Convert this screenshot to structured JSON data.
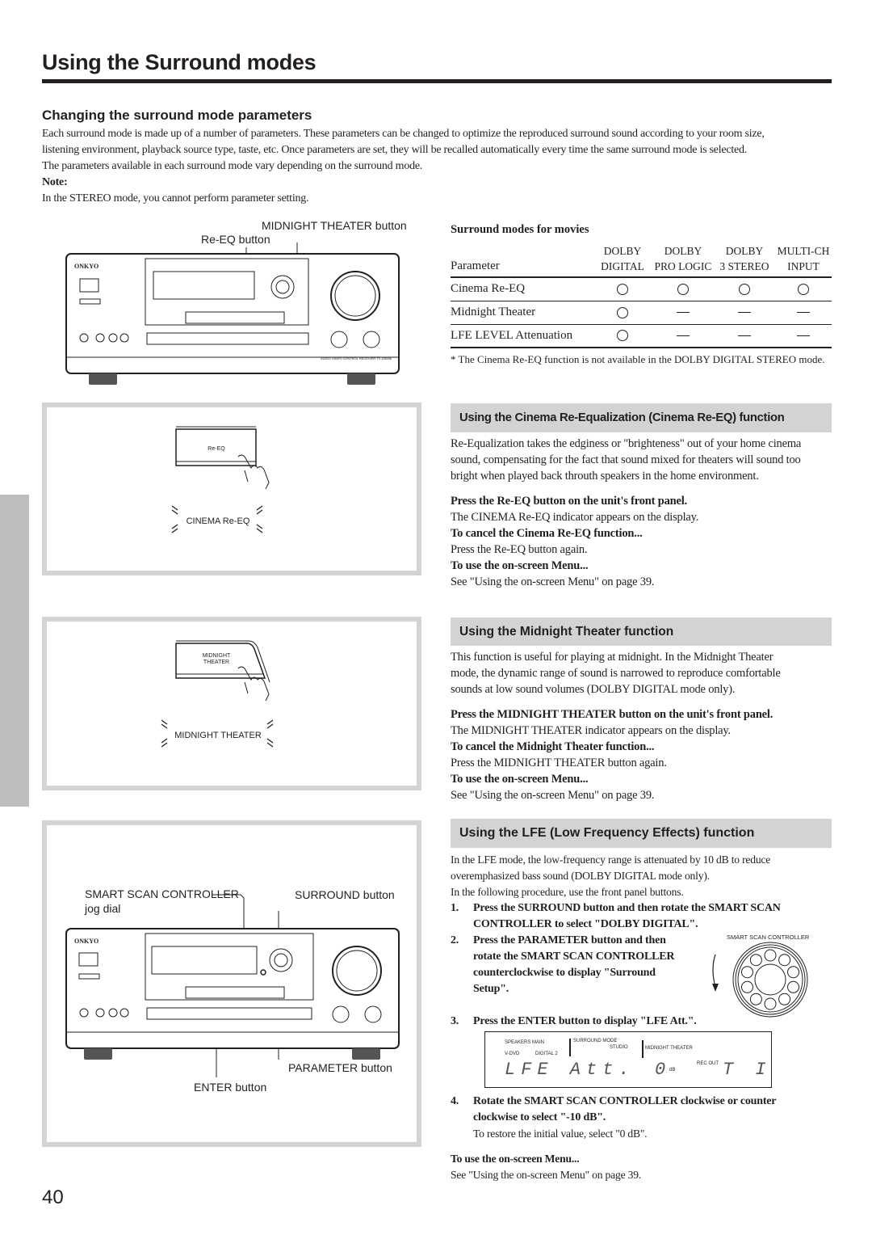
{
  "page": {
    "title": "Using the Surround modes",
    "number": "40"
  },
  "intro": {
    "heading": "Changing the surround mode parameters",
    "lines": [
      "Each surround mode is made up of a number of parameters. These parameters can be changed to optimize the reproduced surround sound according to your room size,",
      "listening environment, playback source type, taste, etc. Once parameters are set, they will be recalled automatically every time the same surround mode is selected.",
      "The parameters available in each surround mode vary depending on the surround mode."
    ],
    "note_label": "Note:",
    "note_text": "In the STEREO mode, you cannot perform parameter setting."
  },
  "figure_top": {
    "callout_midnight": "MIDNIGHT THEATER button",
    "callout_reeq": "Re-EQ button",
    "brand": "ONKYO",
    "model": "AUDIO VIDEO CONTROL RECEIVER  TX-DS656"
  },
  "movies_table": {
    "title": "Surround modes for movies",
    "param_header": "Parameter",
    "columns": [
      {
        "line1": "DOLBY",
        "line2": "DIGITAL"
      },
      {
        "line1": "DOLBY",
        "line2": "PRO LOGIC"
      },
      {
        "line1": "DOLBY",
        "line2": "3 STEREO"
      },
      {
        "line1": "MULTI-CH",
        "line2": "INPUT"
      }
    ],
    "rows": [
      {
        "label": "Cinema Re-EQ",
        "values": [
          "available",
          "available",
          "available",
          "available"
        ]
      },
      {
        "label": "Midnight Theater",
        "values": [
          "available",
          "not-available",
          "not-available",
          "not-available"
        ]
      },
      {
        "label": "LFE LEVEL Attenuation",
        "values": [
          "available",
          "not-available",
          "not-available",
          "not-available"
        ]
      }
    ],
    "footnote": "* The Cinema Re-EQ function is not available in the DOLBY DIGITAL STEREO mode."
  },
  "reeq": {
    "heading": "Using the Cinema Re-Equalization (Cinema Re-EQ) function",
    "body": [
      "Re-Equalization takes the edginess or \"brighteness\" out of your home cinema",
      "sound, compensating for the fact that sound mixed for theaters will sound too",
      "bright when played back throuth speakers in the home environment."
    ],
    "press": "Press the Re-EQ button on the unit's front panel.",
    "press_result": "The CINEMA Re-EQ indicator appears on the display.",
    "cancel_title": "To cancel the Cinema Re-EQ function...",
    "cancel_text": "Press the Re-EQ button again.",
    "menu_title": "To use the on-screen Menu...",
    "menu_text": "See \"Using the on-screen Menu\" on page 39.",
    "figure_button": "Re-EQ",
    "figure_indicator": "CINEMA  Re-EQ"
  },
  "midnight": {
    "heading": "Using the Midnight Theater function",
    "body": [
      "This function is useful for playing at midnight. In the Midnight Theater",
      "mode, the dynamic range of sound is narrowed to reproduce comfortable",
      "sounds at low sound volumes (DOLBY DIGITAL mode only)."
    ],
    "press": "Press the MIDNIGHT THEATER button on the unit's front panel.",
    "press_result": "The MIDNIGHT THEATER indicator appears on the display.",
    "cancel_title": "To cancel the Midnight Theater function...",
    "cancel_text": "Press the MIDNIGHT THEATER button again.",
    "menu_title": "To use the on-screen Menu...",
    "menu_text": "See \"Using the on-screen Menu\" on page 39.",
    "figure_button_1": "MIDNIGHT",
    "figure_button_2": "THEATER",
    "figure_indicator": "MIDNIGHT THEATER"
  },
  "lfe": {
    "heading": "Using the LFE (Low Frequency Effects) function",
    "body": [
      "In the LFE mode, the low-frequency range is attenuated by 10 dB to reduce",
      "overemphasized bass sound (DOLBY DIGITAL mode only).",
      "In the following procedure, use the front panel buttons."
    ],
    "steps": [
      {
        "num": "1.",
        "lines": [
          "Press the SURROUND button and then rotate the SMART SCAN",
          "CONTROLLER to select \"DOLBY DIGITAL\"."
        ]
      },
      {
        "num": "2.",
        "lines": [
          "Press the PARAMETER button and then",
          "rotate the SMART SCAN CONTROLLER",
          "counterclockwise to display \"Surround",
          "Setup\"."
        ]
      },
      {
        "num": "3.",
        "lines": [
          "Press the ENTER button to display \"LFE Att.\"."
        ]
      },
      {
        "num": "4.",
        "lines": [
          "Rotate the SMART SCAN CONTROLLER clockwise or counter",
          "clockwise to select \"-10 dB\"."
        ],
        "sub": "To restore the initial value, select \"0 dB\"."
      }
    ],
    "controller_label": "SMART SCAN CONTROLLER",
    "display": {
      "speakers": "SPEAKERS MAIN",
      "source": "V-DVD",
      "digital": "DIGITAL  2",
      "surround_mode": "SURROUND MODE",
      "studio": "STUDIO",
      "midnight": "MIDNIGHT THEATER",
      "rec_out": "REC OUT",
      "main_text": "LFE Att.",
      "value": "0",
      "unit": "dB",
      "right_text": "T I"
    },
    "menu_title": "To use the on-screen Menu...",
    "menu_text": "See \"Using the on-screen Menu\" on page 39.",
    "figure": {
      "callout_controller_1": "SMART SCAN CONTROLLER",
      "callout_controller_2": "jog dial",
      "callout_surround": "SURROUND button",
      "callout_parameter": "PARAMETER button",
      "callout_enter": "ENTER button"
    }
  }
}
